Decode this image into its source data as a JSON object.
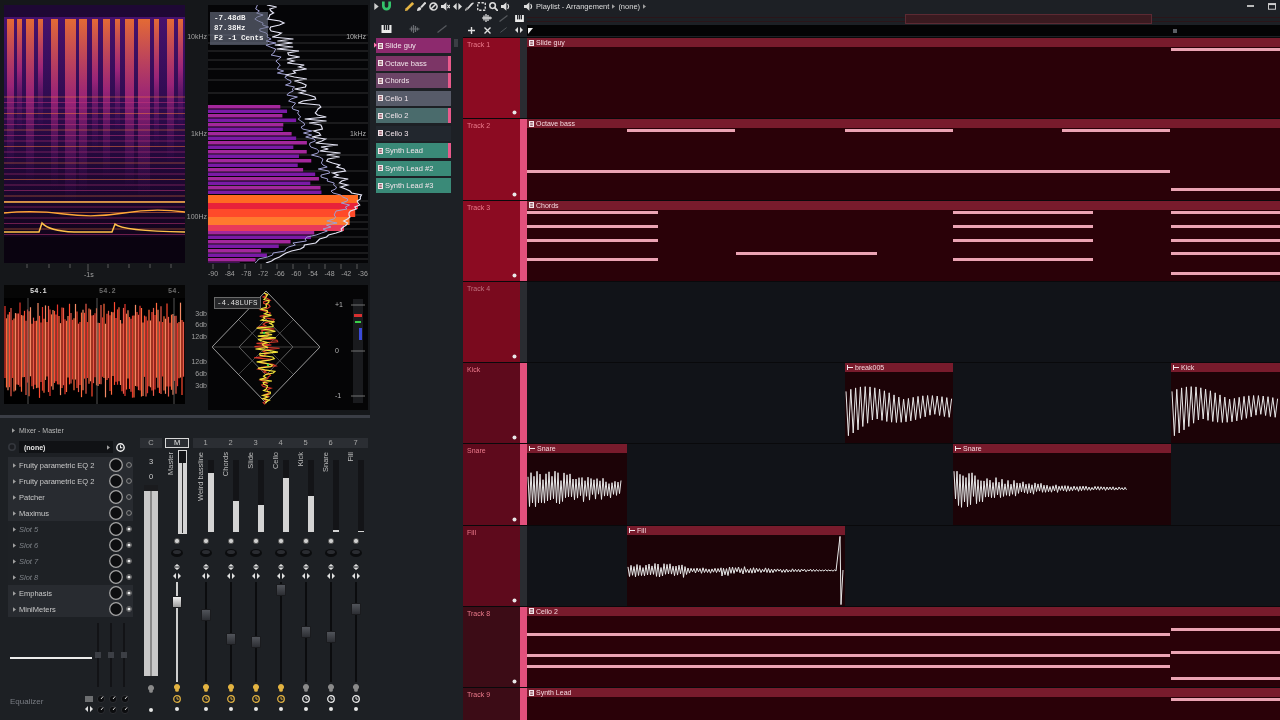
{
  "analyzer": {
    "freq_labels": [
      "10kHz",
      "1kHz",
      "100Hz"
    ],
    "readout": [
      "-7.48dB",
      "87.38Hz",
      "F2 -1 Cents"
    ],
    "freq_labels_right": [
      "10kHz",
      "1kHz"
    ],
    "time_label": "-1s",
    "db_ticks": [
      "-90",
      "-84",
      "-78",
      "-72",
      "-66",
      "-60",
      "-54",
      "-48",
      "-42",
      "-36"
    ],
    "wave_times": [
      {
        "label": "54.1",
        "highlighted": true
      },
      {
        "label": "54.2",
        "highlighted": false
      },
      {
        "label": "54.",
        "highlighted": false
      }
    ],
    "wave_db": [
      "3db",
      "6db",
      "12db",
      "12db",
      "6db",
      "3db"
    ],
    "lufs": "-4.48LUFS",
    "meter_scale": [
      "+1",
      "0",
      "-1"
    ]
  },
  "mixer": {
    "title": "Mixer - Master",
    "preset": "(none)",
    "slots": [
      {
        "label": "Fruity parametric EQ 2",
        "kind": "plugin",
        "on": false
      },
      {
        "label": "Fruity parametric EQ 2",
        "kind": "plugin",
        "on": false
      },
      {
        "label": "Patcher",
        "kind": "plugin",
        "on": false
      },
      {
        "label": "Maximus",
        "kind": "plugin",
        "on": false
      },
      {
        "label": "Slot 5",
        "kind": "empty",
        "on": true
      },
      {
        "label": "Slot 6",
        "kind": "empty",
        "on": true
      },
      {
        "label": "Slot 7",
        "kind": "empty",
        "on": true
      },
      {
        "label": "Slot 8",
        "kind": "empty",
        "on": true
      },
      {
        "label": "Emphasis",
        "kind": "plugin",
        "on": true
      },
      {
        "label": "MiniMeters",
        "kind": "plugin",
        "on": true
      }
    ],
    "eq": {
      "label": "Equalizer",
      "bands": [
        {
          "level": 0.5
        },
        {
          "level": 0.5
        },
        {
          "level": 0.5
        }
      ]
    },
    "strips": [
      {
        "header": "C",
        "kind": "current",
        "selected": false,
        "readouts": [
          "3",
          "0"
        ],
        "meter": {
          "level": 0.97
        },
        "active": false
      },
      {
        "header": "M",
        "kind": "master",
        "name": "Master",
        "selected": true,
        "meter": {
          "level": 0.85
        },
        "fader": {
          "level": 0.84
        },
        "active": true
      },
      {
        "header": "1",
        "kind": "insert",
        "name": "Weird bassline",
        "selected": false,
        "meter": {
          "level": 0.82
        },
        "fader": {
          "level": 0.69
        },
        "active": true
      },
      {
        "header": "2",
        "kind": "insert",
        "name": "Chords",
        "selected": false,
        "meter": {
          "level": 0.43
        },
        "fader": {
          "level": 0.42
        },
        "active": true
      },
      {
        "header": "3",
        "kind": "insert",
        "name": "Slide",
        "selected": false,
        "meter": {
          "level": 0.37
        },
        "fader": {
          "level": 0.39
        },
        "active": true
      },
      {
        "header": "4",
        "kind": "insert",
        "name": "Cello",
        "selected": false,
        "meter": {
          "level": 0.75
        },
        "fader": {
          "level": 0.98
        },
        "active": true
      },
      {
        "header": "5",
        "kind": "insert",
        "name": "Kick",
        "selected": false,
        "meter": {
          "level": 0.5
        },
        "fader": {
          "level": 0.5
        },
        "active": false
      },
      {
        "header": "6",
        "kind": "insert",
        "name": "Snare",
        "selected": false,
        "meter": {
          "level": 0.03
        },
        "fader": {
          "level": 0.44
        },
        "active": false
      },
      {
        "header": "7",
        "kind": "insert",
        "name": "Fill",
        "selected": false,
        "meter": {
          "level": 0.02
        },
        "fader": {
          "level": 0.76
        },
        "active": false
      }
    ]
  },
  "pattern_list": {
    "items": [
      {
        "label": "Slide guy",
        "color": "#8d2a6e",
        "selected": true,
        "marked": false
      },
      {
        "label": "Octave bass",
        "color": "#7c3566",
        "selected": false,
        "marked": true
      },
      {
        "label": "Chords",
        "color": "#6b4466",
        "selected": false,
        "marked": true
      },
      {
        "label": "Cello 1",
        "color": "#575b69",
        "selected": false,
        "marked": false
      },
      {
        "label": "Cello 2",
        "color": "#4a6b6c",
        "selected": false,
        "marked": true
      },
      {
        "label": "Cello 3",
        "color": "#22272e",
        "selected": false,
        "marked": false
      },
      {
        "label": "Synth Lead",
        "color": "#3a8a78",
        "selected": false,
        "marked": true
      },
      {
        "label": "Synth Lead #2",
        "color": "#3a8a78",
        "selected": false,
        "marked": false
      },
      {
        "label": "Synth Lead #3",
        "color": "#3a8a78",
        "selected": false,
        "marked": false
      }
    ]
  },
  "playlist": {
    "title": "Playlist - Arrangement",
    "pattern": "(none)",
    "tracks": [
      {
        "label": "Track 1",
        "color": "#8c0b22",
        "selected": false,
        "dimmed": false,
        "clips": [
          {
            "kind": "pattern",
            "label": "Slide guy"
          }
        ]
      },
      {
        "label": "Track 2",
        "color": "#8c0b22",
        "selected": true,
        "dimmed": false,
        "clips": [
          {
            "kind": "pattern",
            "label": "Octave bass"
          }
        ]
      },
      {
        "label": "Track 3",
        "color": "#8c0b22",
        "selected": true,
        "dimmed": false,
        "clips": [
          {
            "kind": "pattern",
            "label": "Chords"
          }
        ]
      },
      {
        "label": "Track 4",
        "color": "#7a0a1e",
        "selected": false,
        "dimmed": true
      },
      {
        "label": "Kick",
        "color": "#5e0a1c",
        "selected": true,
        "dimmed": false,
        "clips": [
          {
            "kind": "audio",
            "label": "break005"
          },
          {
            "kind": "audio",
            "label": "Kick"
          }
        ]
      },
      {
        "label": "Snare",
        "color": "#5e0a1c",
        "selected": true,
        "dimmed": false,
        "clips": [
          {
            "kind": "audio",
            "label": "Snare"
          },
          {
            "kind": "audio",
            "label": "Snare"
          }
        ]
      },
      {
        "label": "Fill",
        "color": "#5e0a1c",
        "selected": false,
        "dimmed": false,
        "clips": [
          {
            "kind": "audio",
            "label": "Fill"
          }
        ]
      },
      {
        "label": "Track 8",
        "color": "#3c0c16",
        "selected": true,
        "dimmed": false,
        "clips": [
          {
            "kind": "pattern",
            "label": "Cello 2"
          }
        ]
      },
      {
        "label": "Track 9",
        "color": "#3c0c16",
        "selected": true,
        "dimmed": false,
        "clips": [
          {
            "kind": "pattern",
            "label": "Synth Lead"
          }
        ]
      }
    ]
  }
}
